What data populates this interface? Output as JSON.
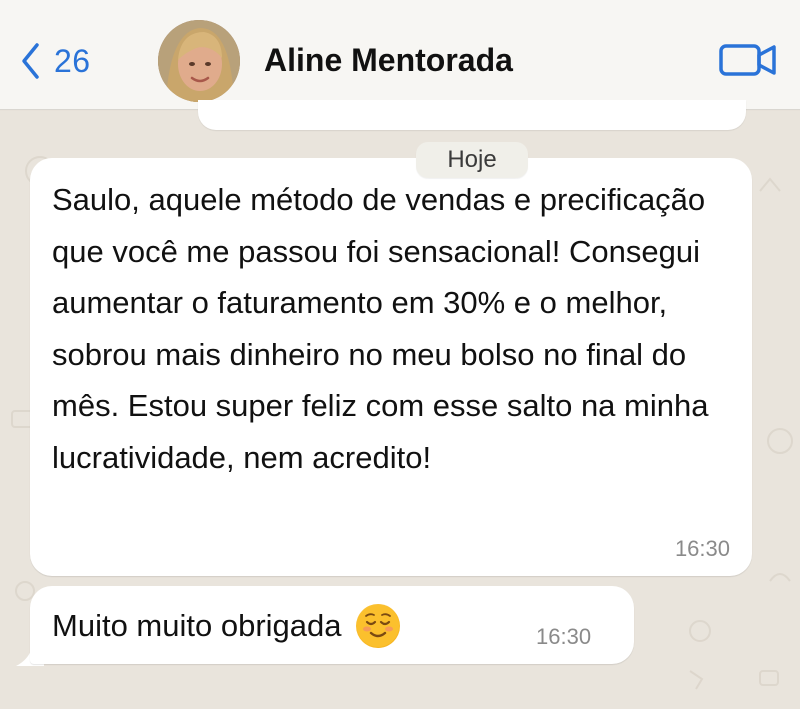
{
  "header": {
    "back_count": "26",
    "contact_name": "Aline Mentorada",
    "icons": {
      "back": "chevron-left-icon",
      "video": "video-camera-icon"
    },
    "accent_color": "#2a73d8"
  },
  "chat": {
    "date_label": "Hoje",
    "messages": [
      {
        "text": "Saulo, aquele método de vendas e precificação que você me passou foi sensacional! Consegui aumentar o faturamento em 30% e o melhor, sobrou mais dinheiro no meu bolso no final do mês. Estou super feliz com esse salto na minha lucratividade, nem acredito!",
        "time": "16:30"
      },
      {
        "text": "Muito muito obrigada",
        "emoji": "relieved-smiling-face-emoji",
        "time": "16:30"
      }
    ]
  }
}
